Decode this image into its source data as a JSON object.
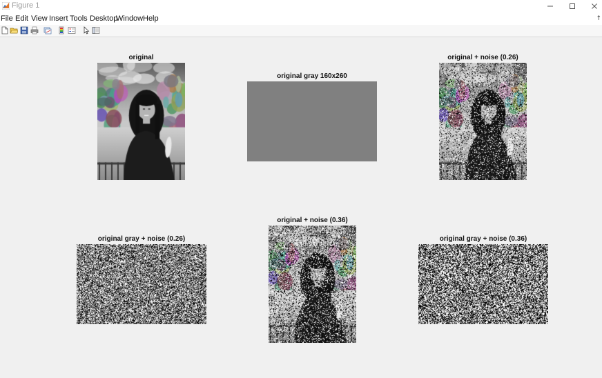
{
  "window": {
    "title": "Figure 1",
    "controls": [
      "minimize",
      "maximize",
      "close"
    ]
  },
  "menubar": {
    "items": [
      "File",
      "Edit",
      "View",
      "Insert",
      "Tools",
      "Desktop",
      "Window",
      "Help"
    ]
  },
  "toolbar": {
    "icons": [
      "new-figure-icon",
      "open-file-icon",
      "save-icon",
      "print-icon",
      "link-plot-icon",
      "insert-colorbar-icon",
      "insert-legend-icon",
      "edit-plot-icon",
      "property-inspector-icon"
    ]
  },
  "axes": [
    {
      "title": "original",
      "content": "grayscale photo"
    },
    {
      "title": "original gray 160x260",
      "content": "uniform gray",
      "fill_color": "#808080"
    },
    {
      "title": "original + noise (0.26)",
      "content": "noisy grayscale photo"
    },
    {
      "title": "original gray + noise (0.26)",
      "content": "noise"
    },
    {
      "title": "original + noise (0.36)",
      "content": "noisy grayscale photo"
    },
    {
      "title": "original gray + noise (0.36)",
      "content": "noise"
    }
  ],
  "colors": {
    "background": "#f0f0f0",
    "gray_fill": "#808080"
  }
}
